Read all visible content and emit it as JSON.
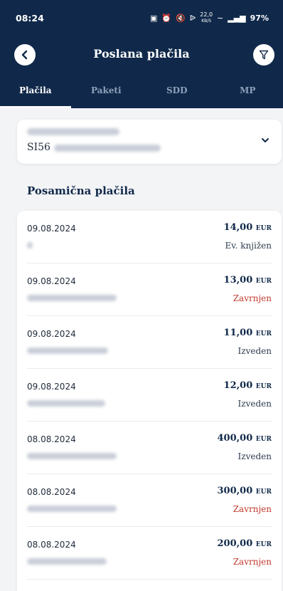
{
  "status_bar": {
    "time": "08:24",
    "speed": "22,0",
    "speed_unit": "KB/S",
    "battery": "97%"
  },
  "header": {
    "title": "Poslana plačila"
  },
  "tabs": [
    {
      "label": "Plačila",
      "active": true
    },
    {
      "label": "Paketi",
      "active": false
    },
    {
      "label": "SDD",
      "active": false
    },
    {
      "label": "MP",
      "active": false
    }
  ],
  "account": {
    "iban_prefix": "SI56"
  },
  "section": {
    "title": "Posamična plačila"
  },
  "payments": [
    {
      "date": "09.08.2024",
      "amount": "14,00",
      "currency": "EUR",
      "status": "Ev. knjižen",
      "status_color": "#2c3a4d"
    },
    {
      "date": "09.08.2024",
      "amount": "13,00",
      "currency": "EUR",
      "status": "Zavrnjen",
      "status_color": "#c0392b"
    },
    {
      "date": "09.08.2024",
      "amount": "11,00",
      "currency": "EUR",
      "status": "Izveden",
      "status_color": "#2c3a4d"
    },
    {
      "date": "09.08.2024",
      "amount": "12,00",
      "currency": "EUR",
      "status": "Izveden",
      "status_color": "#2c3a4d"
    },
    {
      "date": "08.08.2024",
      "amount": "400,00",
      "currency": "EUR",
      "status": "Izveden",
      "status_color": "#2c3a4d"
    },
    {
      "date": "08.08.2024",
      "amount": "300,00",
      "currency": "EUR",
      "status": "Zavrnjen",
      "status_color": "#c0392b"
    },
    {
      "date": "08.08.2024",
      "amount": "200,00",
      "currency": "EUR",
      "status": "Zavrnjen",
      "status_color": "#c0392b"
    }
  ],
  "colors": {
    "header_bg": "#10294a",
    "accent": "#10294a",
    "rejected": "#c0392b"
  }
}
